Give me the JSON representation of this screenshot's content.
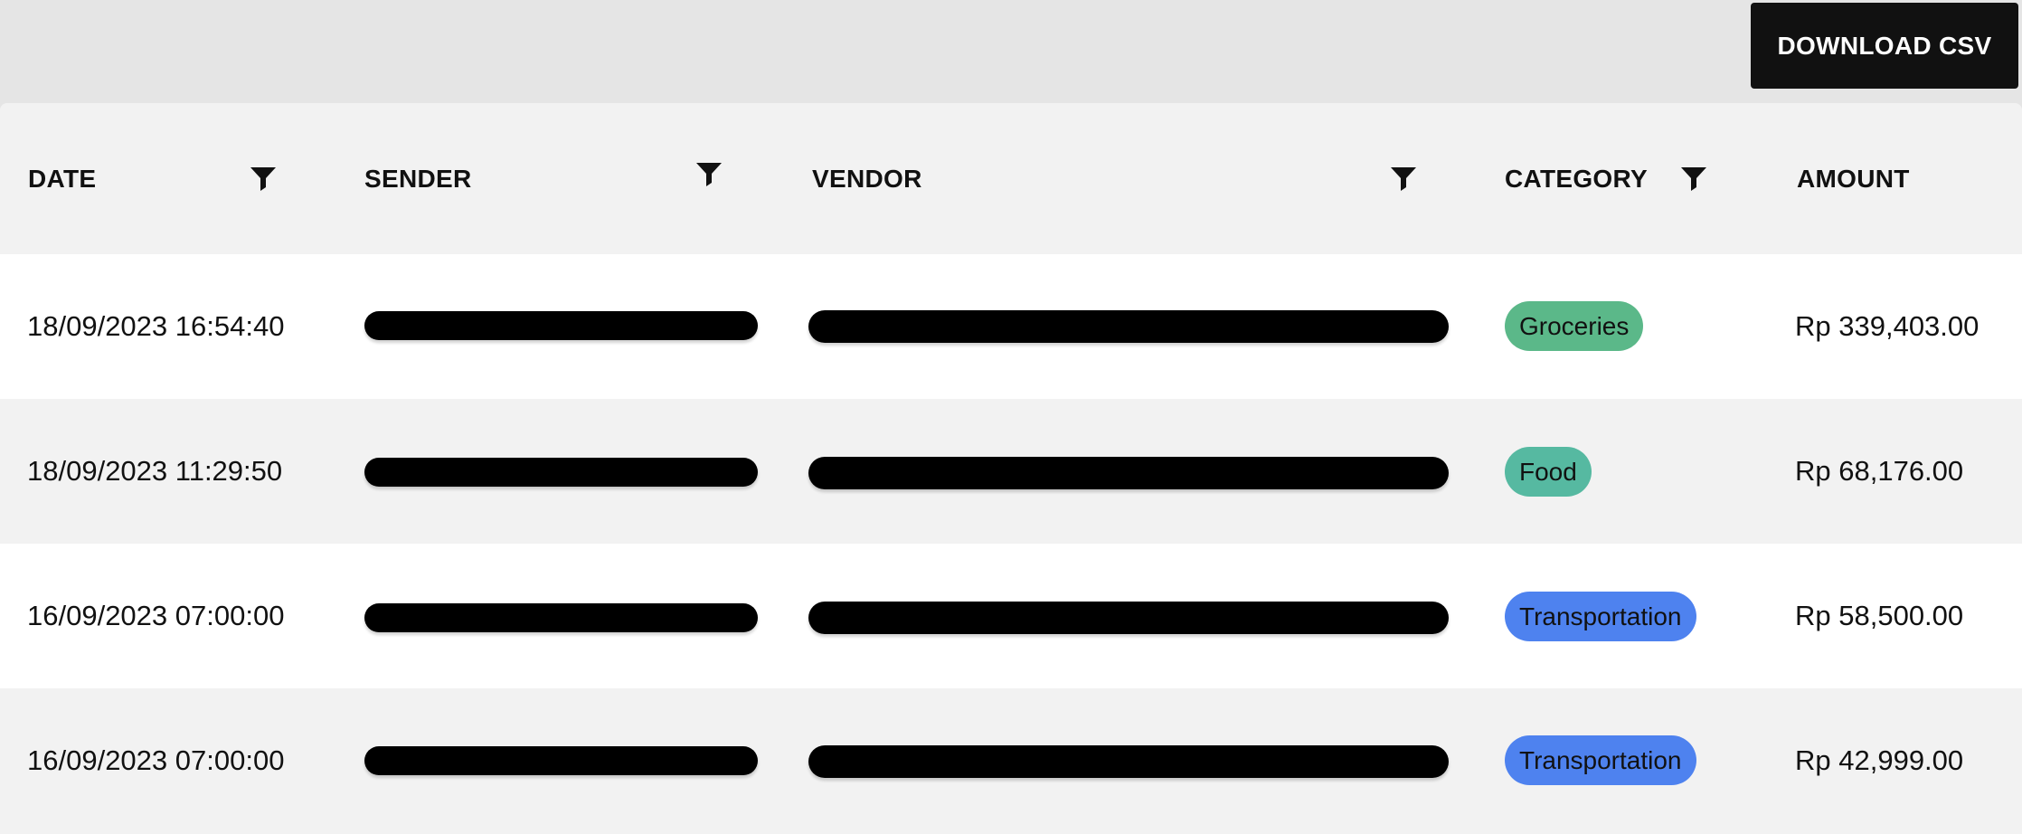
{
  "toolbar": {
    "download_label": "DOWNLOAD CSV"
  },
  "table": {
    "columns": [
      {
        "key": "date",
        "label": "DATE",
        "filterable": true
      },
      {
        "key": "sender",
        "label": "SENDER",
        "filterable": true
      },
      {
        "key": "vendor",
        "label": "VENDOR",
        "filterable": true
      },
      {
        "key": "category",
        "label": "CATEGORY",
        "filterable": true
      },
      {
        "key": "amount",
        "label": "AMOUNT",
        "filterable": false
      }
    ],
    "rows": [
      {
        "date": "18/09/2023 16:54:40",
        "sender": "[redacted]",
        "vendor": "[redacted]",
        "category": "Groceries",
        "amount": "Rp 339,403.00"
      },
      {
        "date": "18/09/2023 11:29:50",
        "sender": "[redacted]",
        "vendor": "[redacted]",
        "category": "Food",
        "amount": "Rp 68,176.00"
      },
      {
        "date": "16/09/2023 07:00:00",
        "sender": "[redacted]",
        "vendor": "[redacted]",
        "category": "Transportation",
        "amount": "Rp 58,500.00"
      },
      {
        "date": "16/09/2023 07:00:00",
        "sender": "[redacted]",
        "vendor": "[redacted]",
        "category": "Transportation",
        "amount": "Rp 42,999.00"
      }
    ]
  },
  "category_colors": {
    "Groceries": "#5bb889",
    "Food": "#56b9a1",
    "Transportation": "#4e82ef"
  },
  "icons": {
    "filter": "filter-icon"
  }
}
